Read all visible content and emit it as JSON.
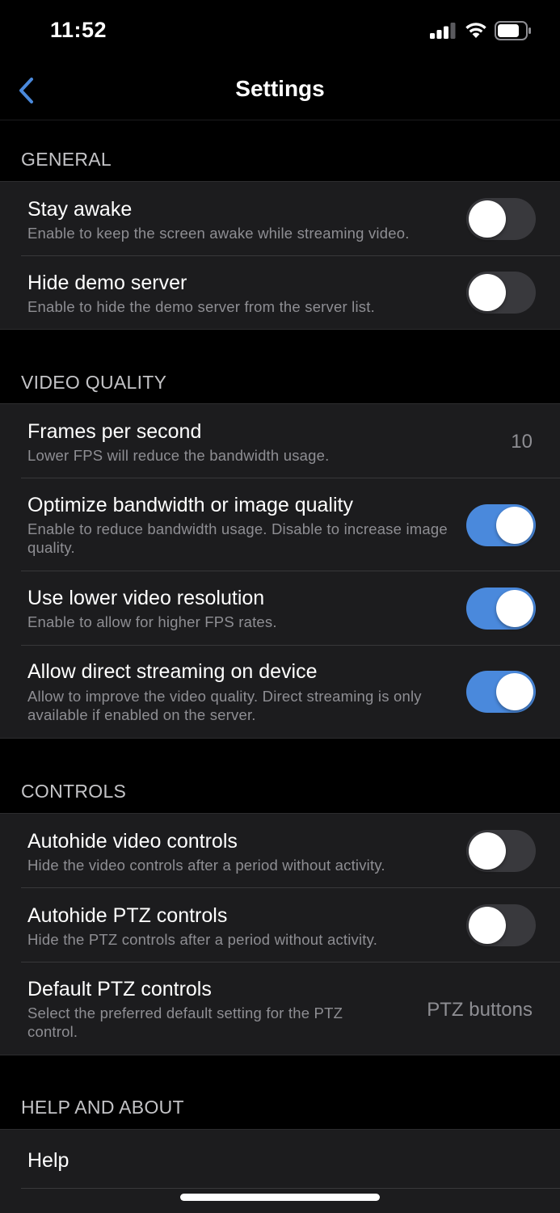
{
  "status_bar": {
    "time": "11:52",
    "icons": [
      "cellular-signal-icon",
      "wifi-icon",
      "battery-icon"
    ]
  },
  "nav": {
    "title": "Settings",
    "back_icon": "chevron-left-icon"
  },
  "colors": {
    "accent": "#4a89dc",
    "background": "#000000",
    "cell_background": "#1c1c1e",
    "secondary_text": "#8e8e93",
    "toggle_off": "#39393d"
  },
  "sections": {
    "general": {
      "header": "GENERAL",
      "items": [
        {
          "title": "Stay awake",
          "subtitle": "Enable to keep the screen awake while streaming video.",
          "toggle": false
        },
        {
          "title": "Hide demo server",
          "subtitle": "Enable to hide the demo server from the server list.",
          "toggle": false
        }
      ]
    },
    "video_quality": {
      "header": "VIDEO QUALITY",
      "items": [
        {
          "title": "Frames per second",
          "subtitle": "Lower FPS will reduce the bandwidth usage.",
          "value": "10"
        },
        {
          "title": "Optimize bandwidth or image quality",
          "subtitle": "Enable to reduce bandwidth usage. Disable to increase image quality.",
          "toggle": true
        },
        {
          "title": "Use lower video resolution",
          "subtitle": "Enable to allow for higher FPS rates.",
          "toggle": true
        },
        {
          "title": "Allow direct streaming on device",
          "subtitle": "Allow to improve the video quality. Direct streaming is only available if enabled on the server.",
          "toggle": true
        }
      ]
    },
    "controls": {
      "header": "CONTROLS",
      "items": [
        {
          "title": "Autohide video controls",
          "subtitle": "Hide the video controls after a period without activity.",
          "toggle": false
        },
        {
          "title": "Autohide PTZ controls",
          "subtitle": "Hide the PTZ controls after a period without activity.",
          "toggle": false
        },
        {
          "title": "Default PTZ controls",
          "subtitle": "Select the preferred default setting for the PTZ control.",
          "value": "PTZ buttons"
        }
      ]
    },
    "help_about": {
      "header": "HELP AND ABOUT",
      "items": [
        {
          "title": "Help"
        }
      ]
    }
  }
}
